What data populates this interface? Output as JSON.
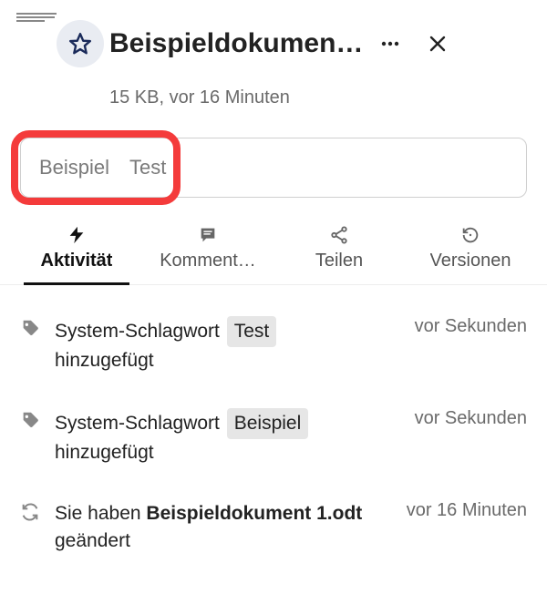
{
  "header": {
    "title": "Beispieldokumen…",
    "subtitle": "15 KB, vor 16 Minuten"
  },
  "tags": {
    "items": [
      "Beispiel",
      "Test"
    ]
  },
  "tabs": {
    "activity": "Aktivität",
    "comments": "Komment…",
    "share": "Teilen",
    "versions": "Versionen"
  },
  "activity": [
    {
      "icon": "tag",
      "prefix": "System-Schlagwort",
      "pill": "Test",
      "suffix": "hinzugefügt",
      "time": "vor Sekunden"
    },
    {
      "icon": "tag",
      "prefix": "System-Schlagwort",
      "pill": "Beispiel",
      "suffix": "hinzugefügt",
      "time": "vor Sekunden"
    },
    {
      "icon": "sync",
      "text_before": "Sie haben ",
      "strong": "Beispieldokument 1.odt",
      "text_after": " geändert",
      "time": "vor 16 Minuten"
    }
  ]
}
